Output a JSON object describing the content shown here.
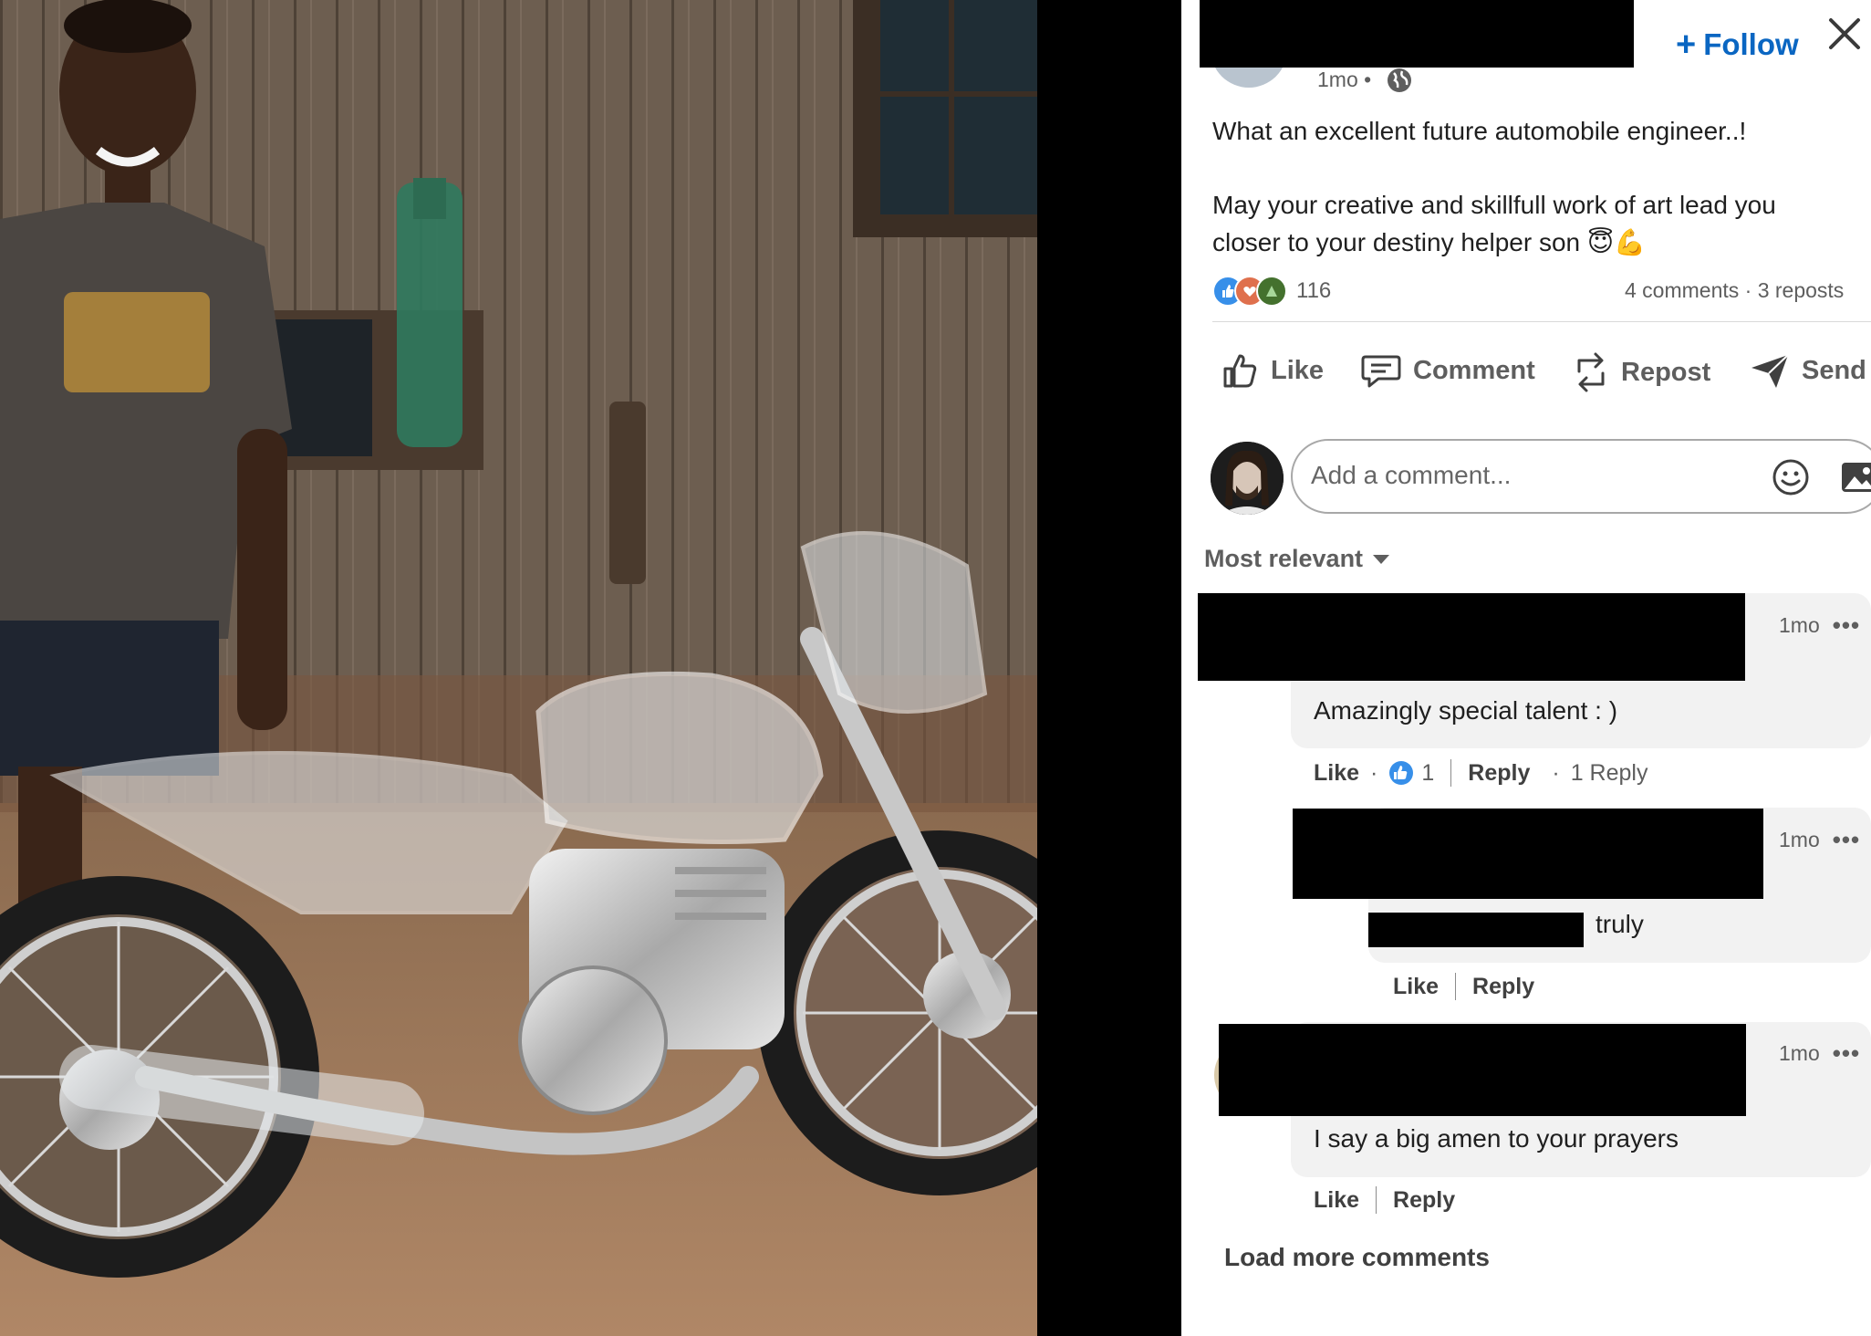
{
  "post": {
    "time": "1mo •",
    "follow_label": "Follow",
    "text_line1": "What an excellent future automobile engineer..!",
    "text_line2": "May your creative and skillfull work of art lead you",
    "text_line3": "closer to your destiny helper son 😇💪",
    "reaction_count": "116",
    "stats": "4 comments · 3 reposts"
  },
  "actions": {
    "like": "Like",
    "comment": "Comment",
    "repost": "Repost",
    "send": "Send"
  },
  "composer": {
    "placeholder": "Add a comment..."
  },
  "sort_label": "Most relevant",
  "comments": [
    {
      "time": "1mo",
      "text": "Amazingly special talent : )",
      "like": "Like",
      "like_count": "1",
      "reply": "Reply",
      "replies_label": "1 Reply"
    },
    {
      "time": "1mo",
      "text": "truly",
      "like": "Like",
      "reply": "Reply"
    },
    {
      "time": "1mo",
      "text": "I say a big amen to your prayers",
      "like": "Like",
      "reply": "Reply"
    }
  ],
  "load_more": "Load more comments",
  "colors": {
    "accent": "#0a66c2",
    "muted_text": "#5e5e5e",
    "bubble": "#f2f2f2"
  }
}
